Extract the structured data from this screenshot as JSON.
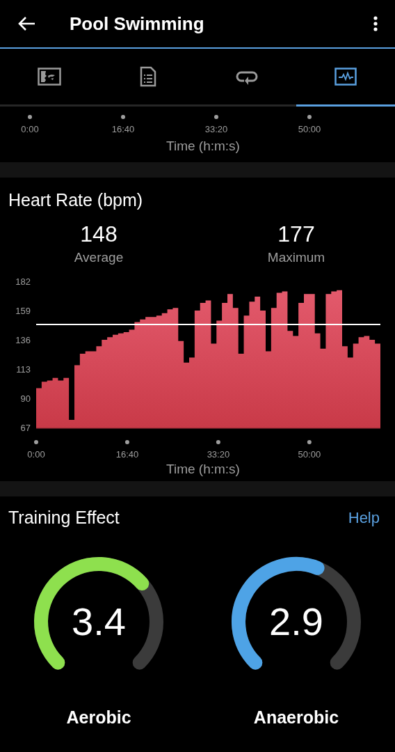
{
  "header": {
    "title": "Pool Swimming"
  },
  "tabs": [
    {
      "selected": false
    },
    {
      "selected": false
    },
    {
      "selected": false
    },
    {
      "selected": true
    }
  ],
  "previous_chart_axis": {
    "xtick_labels": [
      "0:00",
      "16:40",
      "33:20",
      "50:00"
    ],
    "xlabel": "Time (h:m:s)"
  },
  "heart_rate": {
    "title": "Heart Rate (bpm)",
    "stats": [
      {
        "value": "148",
        "label": "Average"
      },
      {
        "value": "177",
        "label": "Maximum"
      }
    ],
    "chart_data": {
      "type": "area",
      "xlabel": "Time (h:m:s)",
      "xlim": [
        0,
        3780
      ],
      "ylim": [
        67,
        182
      ],
      "x": [
        0,
        60,
        120,
        180,
        240,
        300,
        360,
        420,
        480,
        540,
        600,
        660,
        720,
        780,
        840,
        900,
        960,
        1020,
        1080,
        1140,
        1200,
        1260,
        1320,
        1380,
        1440,
        1500,
        1560,
        1620,
        1680,
        1740,
        1800,
        1860,
        1920,
        1980,
        2040,
        2100,
        2160,
        2220,
        2280,
        2340,
        2400,
        2460,
        2520,
        2580,
        2640,
        2700,
        2760,
        2820,
        2880,
        2940,
        3000,
        3060,
        3120,
        3180,
        3240,
        3300,
        3360,
        3420,
        3480,
        3540,
        3600,
        3660,
        3720,
        3780
      ],
      "series": [
        {
          "color": "#c93a48",
          "values": [
            98,
            103,
            104,
            106,
            104,
            106,
            73,
            116,
            125,
            127,
            127,
            131,
            136,
            138,
            140,
            141,
            142,
            144,
            150,
            152,
            154,
            154,
            155,
            157,
            160,
            161,
            135,
            118,
            122,
            159,
            165,
            167,
            133,
            151,
            165,
            172,
            161,
            125,
            155,
            166,
            170,
            159,
            127,
            161,
            173,
            174,
            143,
            139,
            165,
            172,
            172,
            141,
            129,
            172,
            174,
            175,
            131,
            122,
            133,
            138,
            139,
            136,
            133,
            131
          ]
        },
        {
          "type": "line",
          "color": "#ffffff",
          "values": [
            148,
            148,
            148,
            148,
            148,
            148,
            148,
            148,
            148,
            148,
            148,
            148,
            148,
            148,
            148,
            148,
            148,
            148,
            148,
            148,
            148,
            148,
            148,
            148,
            148,
            148,
            148,
            148,
            148,
            148,
            148,
            148,
            148,
            148,
            148,
            148,
            148,
            148,
            148,
            148,
            148,
            148,
            148,
            148,
            148,
            148,
            148,
            148,
            148,
            148,
            148,
            148,
            148,
            148,
            148,
            148,
            148,
            148,
            148,
            148,
            148,
            148,
            148,
            148
          ]
        }
      ],
      "xticks": [
        {
          "value": 0,
          "label": "0:00"
        },
        {
          "value": 1000,
          "label": "16:40"
        },
        {
          "value": 2000,
          "label": "33:20"
        },
        {
          "value": 3000,
          "label": "50:00"
        }
      ],
      "yticks": [
        67,
        90,
        113,
        136,
        159,
        182
      ]
    }
  },
  "training_effect": {
    "title": "Training Effect",
    "help": "Help",
    "gauges": [
      {
        "value": "3.4",
        "label": "Aerobic",
        "color": "#8ee04e"
      },
      {
        "value": "2.9",
        "label": "Anaerobic",
        "color": "#4ea3e6"
      }
    ]
  }
}
